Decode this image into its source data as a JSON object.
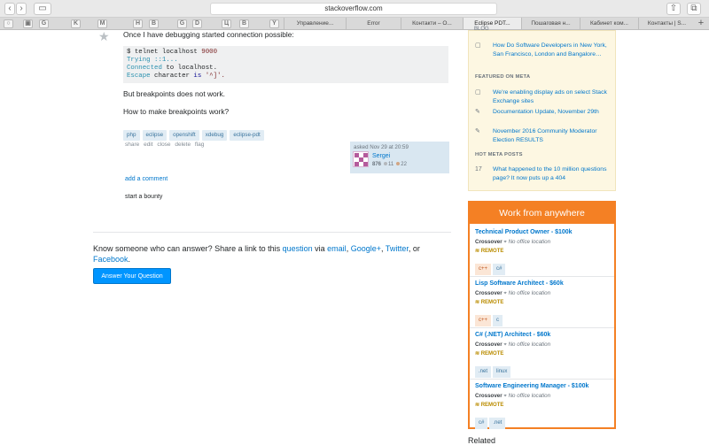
{
  "browser": {
    "url": "stackoverflow.com",
    "favicons": [
      "○",
      "▣",
      "G",
      "K",
      "M",
      "H",
      "B",
      "G",
      "D",
      "Ц",
      "B",
      "Y"
    ],
    "tabs": [
      {
        "label": "Управление..."
      },
      {
        "label": "Error"
      },
      {
        "label": "Контакти – О..."
      },
      {
        "label": "Eclipse PDT..."
      },
      {
        "label": "Пошаговая н..."
      },
      {
        "label": "Кабинет ком..."
      },
      {
        "label": "Контакты | S..."
      }
    ],
    "active_tab_index": 3
  },
  "question": {
    "intro": "Once I have debugging started connection possible:",
    "code": {
      "line1_prefix": "$ telnet localhost ",
      "line1_num": "9000",
      "line2": "Trying ::1...",
      "line3_kw": "Connected",
      "line3_rest": " to localhost.",
      "line4_kw": "Escape",
      "line4_mid": " character ",
      "line4_is": "is",
      "line4_end": " '^]'."
    },
    "p1": "But breakpoints does not work.",
    "p2": "How to make breakpoints work?",
    "tags": [
      "php",
      "eclipse",
      "openshift",
      "xdebug",
      "eclipse-pdt"
    ],
    "actions": [
      "share",
      "edit",
      "close",
      "delete",
      "flag"
    ],
    "asked": "asked Nov 29 at 20:59",
    "user": {
      "name": "Sergei",
      "rep": "876",
      "silver": "11",
      "bronze": "22"
    },
    "add_comment": "add a comment",
    "bounty": "start a bounty"
  },
  "share": {
    "text1": "Know someone who can answer? Share a link to this ",
    "link_question": "question",
    "text2": " via ",
    "link_email": "email",
    "text3": ", ",
    "link_google": "Google+",
    "text4": ", ",
    "link_twitter": "Twitter",
    "text5": ", or",
    "link_facebook": "Facebook",
    "text6": ".",
    "button": "Answer Your Question"
  },
  "sidebar": {
    "blog_label": "BLOG",
    "blog_item": "How Do Software Developers in New York, San Francisco, London and Bangalore…",
    "featured_label": "FEATURED ON META",
    "meta_items": [
      "We're enabling display ads on select Stack Exchange sites",
      "Documentation Update, November 29th",
      "November 2016 Community Moderator Election RESULTS"
    ],
    "hot_label": "HOT META POSTS",
    "hot_item_count": "17",
    "hot_item": "What happened to the 10 million questions page? It now puts up a 404"
  },
  "jobs": {
    "header": "Work from anywhere",
    "listings": [
      {
        "title": "Technical Product Owner - $100k",
        "company": "Crossover",
        "location": "No office location",
        "remote": "REMOTE",
        "tags": [
          "c++",
          "c#"
        ]
      },
      {
        "title": "Lisp Software Architect - $60k",
        "company": "Crossover",
        "location": "No office location",
        "remote": "REMOTE",
        "tags": [
          "c++",
          "c"
        ]
      },
      {
        "title": "C# (.NET) Architect - $60k",
        "company": "Crossover",
        "location": "No office location",
        "remote": "REMOTE",
        "tags": [
          ".net",
          "linux"
        ]
      },
      {
        "title": "Software Engineering Manager - $100k",
        "company": "Crossover",
        "location": "No office location",
        "remote": "REMOTE",
        "tags": [
          "c#",
          ".net"
        ]
      }
    ]
  },
  "related_label": "Related"
}
